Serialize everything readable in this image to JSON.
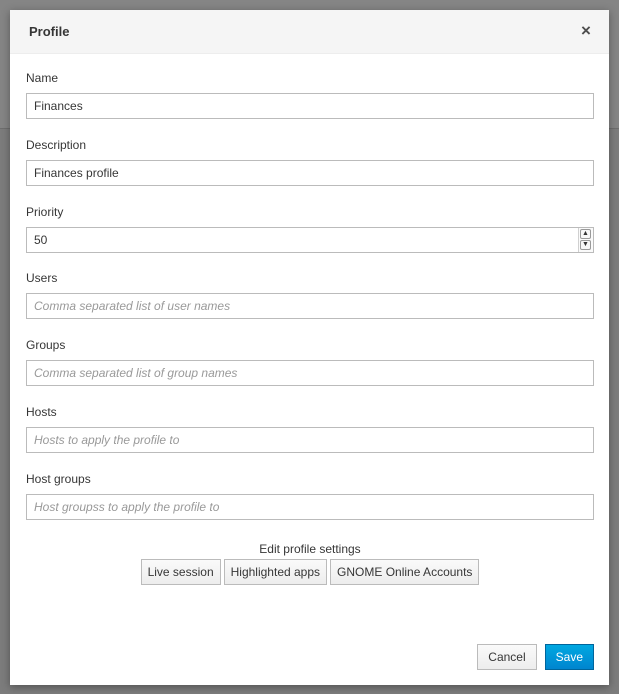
{
  "modal": {
    "title": "Profile",
    "close_glyph": "×"
  },
  "fields": {
    "name": {
      "label": "Name",
      "value": "Finances"
    },
    "description": {
      "label": "Description",
      "value": "Finances profile"
    },
    "priority": {
      "label": "Priority",
      "value": "50"
    },
    "users": {
      "label": "Users",
      "placeholder": "Comma separated list of user names"
    },
    "groups": {
      "label": "Groups",
      "placeholder": "Comma separated list of group names"
    },
    "hosts": {
      "label": "Hosts",
      "placeholder": "Hosts to apply the profile to"
    },
    "host_groups": {
      "label": "Host groups",
      "placeholder": "Host groupss to apply the profile to"
    }
  },
  "settings": {
    "title": "Edit profile settings",
    "buttons": {
      "live_session": "Live session",
      "highlighted_apps": "Highlighted apps",
      "gnome_online_accounts": "GNOME Online Accounts"
    }
  },
  "footer": {
    "cancel_label": "Cancel",
    "save_label": "Save"
  },
  "icons": {
    "close": "close-icon",
    "spin_up": "chevron-up-icon",
    "spin_down": "chevron-down-icon"
  },
  "colors": {
    "primary": "#0088ce",
    "header_bg": "#f5f5f5",
    "backdrop": "#7c7c7c"
  }
}
